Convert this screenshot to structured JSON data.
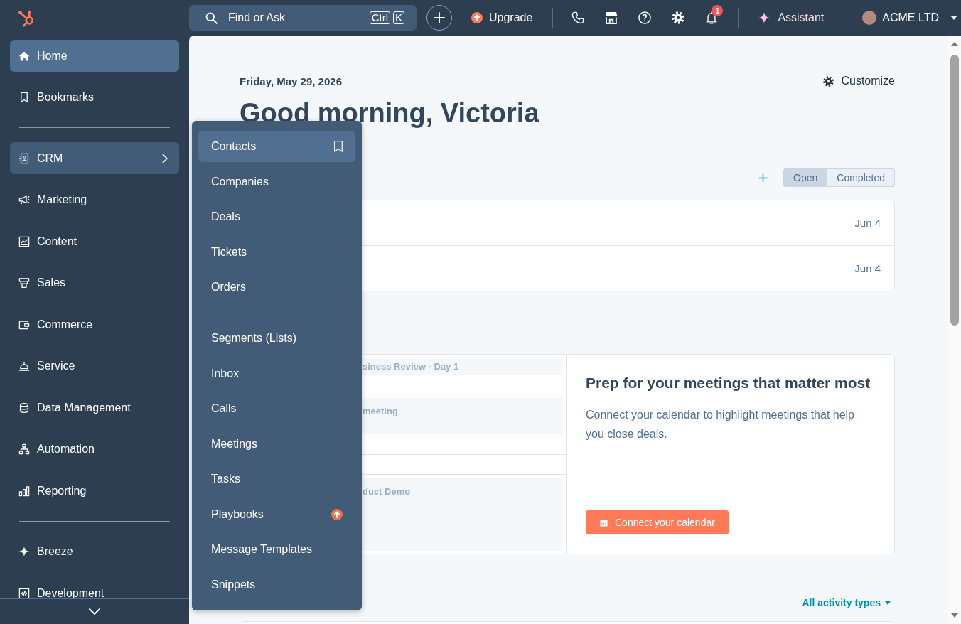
{
  "top_bar": {
    "search": {
      "placeholder": "Find or Ask",
      "shortcut_keys": [
        "Ctrl",
        "K"
      ]
    },
    "upgrade": "Upgrade",
    "notification_count": "1",
    "assistant": "Assistant",
    "account": "ACME LTD"
  },
  "sidebar": {
    "groups": [
      {
        "items": [
          {
            "label": "Home",
            "selected": true,
            "expanded": false
          },
          {
            "label": "Bookmarks",
            "selected": false,
            "expanded": false
          }
        ]
      },
      {
        "items": [
          {
            "label": "CRM",
            "selected": false,
            "expanded": true
          },
          {
            "label": "Marketing",
            "selected": false,
            "expanded": false
          },
          {
            "label": "Content",
            "selected": false,
            "expanded": false
          },
          {
            "label": "Sales",
            "selected": false,
            "expanded": false
          },
          {
            "label": "Commerce",
            "selected": false,
            "expanded": false
          },
          {
            "label": "Service",
            "selected": false,
            "expanded": false
          },
          {
            "label": "Data Management",
            "selected": false,
            "expanded": false
          },
          {
            "label": "Automation",
            "selected": false,
            "expanded": false
          },
          {
            "label": "Reporting",
            "selected": false,
            "expanded": false
          }
        ]
      },
      {
        "items": [
          {
            "label": "Breeze",
            "selected": false,
            "expanded": false
          },
          {
            "label": "Development",
            "selected": false,
            "expanded": false
          }
        ]
      }
    ]
  },
  "crm_menu": {
    "groups": [
      {
        "items": [
          {
            "label": "Contacts",
            "selected": true,
            "upgrade": false
          },
          {
            "label": "Companies",
            "selected": false,
            "upgrade": false
          },
          {
            "label": "Deals",
            "selected": false,
            "upgrade": false
          },
          {
            "label": "Tickets",
            "selected": false,
            "upgrade": false
          },
          {
            "label": "Orders",
            "selected": false,
            "upgrade": false
          }
        ]
      },
      {
        "items": [
          {
            "label": "Segments (Lists)",
            "selected": false,
            "upgrade": false
          },
          {
            "label": "Inbox",
            "selected": false,
            "upgrade": false
          },
          {
            "label": "Calls",
            "selected": false,
            "upgrade": false
          },
          {
            "label": "Meetings",
            "selected": false,
            "upgrade": false
          },
          {
            "label": "Tasks",
            "selected": false,
            "upgrade": false
          },
          {
            "label": "Playbooks",
            "selected": false,
            "upgrade": true
          },
          {
            "label": "Message Templates",
            "selected": false,
            "upgrade": false
          },
          {
            "label": "Snippets",
            "selected": false,
            "upgrade": false
          }
        ]
      }
    ]
  },
  "header": {
    "date": "Friday, May 29, 2026",
    "greeting": "Good morning, Victoria",
    "customize": "Customize"
  },
  "tasks": {
    "filters": [
      {
        "label": "Open",
        "selected": true
      },
      {
        "label": "Completed",
        "selected": false
      }
    ],
    "rows": [
      {
        "due": "Jun 4"
      },
      {
        "due": "Jun 4"
      }
    ]
  },
  "meetings": {
    "slots": [
      {
        "kind": "event",
        "title": "siness Review - Day 1"
      },
      {
        "kind": "event",
        "title": "meeting"
      },
      {
        "kind": "empty"
      },
      {
        "kind": "event",
        "title": "duct Demo"
      }
    ],
    "prep": {
      "title": "Prep for your meetings that matter most",
      "text": "Connect your calendar to highlight meetings that help you close deals.",
      "button": "Connect your calendar"
    }
  },
  "activity": {
    "filter": "All activity types"
  }
}
